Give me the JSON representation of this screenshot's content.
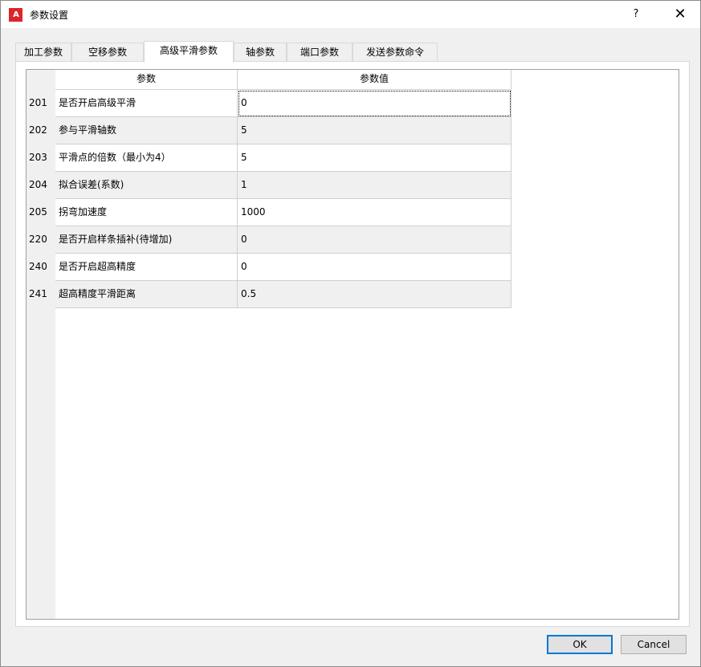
{
  "window": {
    "title": "参数设置",
    "app_icon_text": "A",
    "help_label": "?",
    "close_label": "✕"
  },
  "tabs": [
    {
      "label": "加工参数",
      "active": false
    },
    {
      "label": "空移参数",
      "active": false
    },
    {
      "label": "高级平滑参数",
      "active": true
    },
    {
      "label": "轴参数",
      "active": false
    },
    {
      "label": "端口参数",
      "active": false
    },
    {
      "label": "发送参数命令",
      "active": false
    }
  ],
  "grid": {
    "headers": {
      "name": "参数",
      "value": "参数值"
    },
    "rows": [
      {
        "id": "201",
        "name": "是否开启高级平滑",
        "value": "0"
      },
      {
        "id": "202",
        "name": "参与平滑轴数",
        "value": "5"
      },
      {
        "id": "203",
        "name": "平滑点的倍数（最小为4）",
        "value": "5"
      },
      {
        "id": "204",
        "name": "拟合误差(系数)",
        "value": "1"
      },
      {
        "id": "205",
        "name": "拐弯加速度",
        "value": "1000"
      },
      {
        "id": "220",
        "name": "是否开启样条插补(待增加)",
        "value": "0"
      },
      {
        "id": "240",
        "name": "是否开启超高精度",
        "value": "0"
      },
      {
        "id": "241",
        "name": "超高精度平滑距离",
        "value": "0.5"
      }
    ]
  },
  "buttons": {
    "ok_label": "OK",
    "cancel_label": "Cancel"
  },
  "colors": {
    "app_icon": "#d9262c",
    "ok_border": "#0078d7"
  }
}
